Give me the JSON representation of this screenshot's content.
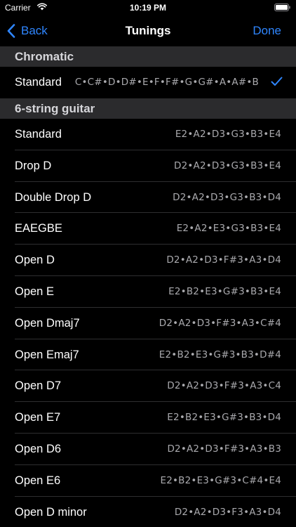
{
  "status_bar": {
    "carrier": "Carrier",
    "time": "10:19 PM"
  },
  "nav": {
    "back_label": "Back",
    "title": "Tunings",
    "done_label": "Done"
  },
  "colors": {
    "accent": "#2f86ff",
    "section_bg": "#2b2b2d",
    "row_bg": "#000000",
    "notes_text": "#a9a9ad"
  },
  "sections": [
    {
      "title": "Chromatic",
      "rows": [
        {
          "label": "Standard",
          "notes": "C•C#•D•D#•E•F•F#•G•G#•A•A#•B",
          "selected": true
        }
      ]
    },
    {
      "title": "6-string guitar",
      "rows": [
        {
          "label": "Standard",
          "notes": "E2•A2•D3•G3•B3•E4"
        },
        {
          "label": "Drop D",
          "notes": "D2•A2•D3•G3•B3•E4"
        },
        {
          "label": "Double Drop D",
          "notes": "D2•A2•D3•G3•B3•D4"
        },
        {
          "label": "EAEGBE",
          "notes": "E2•A2•E3•G3•B3•E4"
        },
        {
          "label": "Open D",
          "notes": "D2•A2•D3•F#3•A3•D4"
        },
        {
          "label": "Open E",
          "notes": "E2•B2•E3•G#3•B3•E4"
        },
        {
          "label": "Open Dmaj7",
          "notes": "D2•A2•D3•F#3•A3•C#4"
        },
        {
          "label": "Open Emaj7",
          "notes": "E2•B2•E3•G#3•B3•D#4"
        },
        {
          "label": "Open D7",
          "notes": "D2•A2•D3•F#3•A3•C4"
        },
        {
          "label": "Open E7",
          "notes": "E2•B2•E3•G#3•B3•D4"
        },
        {
          "label": "Open D6",
          "notes": "D2•A2•D3•F#3•A3•B3"
        },
        {
          "label": "Open E6",
          "notes": "E2•B2•E3•G#3•C#4•E4"
        },
        {
          "label": "Open D minor",
          "notes": "D2•A2•D3•F3•A3•D4"
        }
      ]
    }
  ]
}
